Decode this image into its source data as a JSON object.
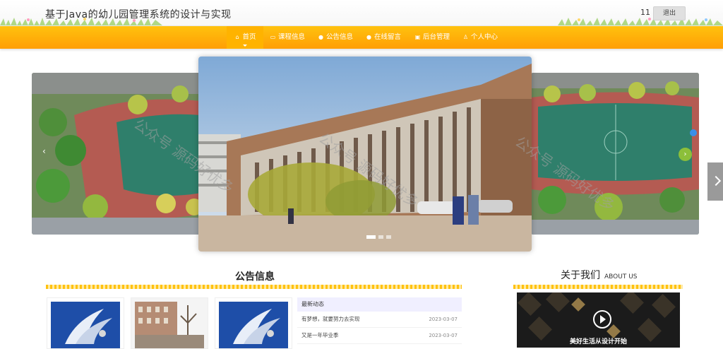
{
  "header": {
    "site_title": "基于Java的幼儿园管理系统的设计与实现",
    "user_name": "11",
    "logout_label": "退出"
  },
  "nav": {
    "items": [
      {
        "label": "首页",
        "icon": "home-icon",
        "active": true
      },
      {
        "label": "课程信息",
        "icon": "bag-icon",
        "active": false
      },
      {
        "label": "公告信息",
        "icon": "info-icon",
        "active": false
      },
      {
        "label": "在线留言",
        "icon": "chat-icon",
        "active": false
      },
      {
        "label": "后台管理",
        "icon": "briefcase-icon",
        "active": false
      },
      {
        "label": "个人中心",
        "icon": "user-icon",
        "active": false
      }
    ]
  },
  "carousel": {
    "slides": [
      "campus-aerial-photo",
      "building-photo",
      "campus-aerial-photo"
    ],
    "active_index": 0
  },
  "watermark": {
    "text": "公众号 源码好优多"
  },
  "notices": {
    "title": "公告信息",
    "news_header": "最新动态",
    "news": [
      {
        "title": "有梦想，就要努力去实现",
        "date": "2023-03-07"
      },
      {
        "title": "又是一年毕业季",
        "date": "2023-03-07"
      }
    ]
  },
  "about": {
    "title": "关于我们",
    "subtitle": "ABOUT US",
    "caption": "美好生活从设计开始"
  },
  "colors": {
    "nav_top": "#ffc20e",
    "nav_bottom": "#ff9e05",
    "accent": "#ffb300"
  }
}
